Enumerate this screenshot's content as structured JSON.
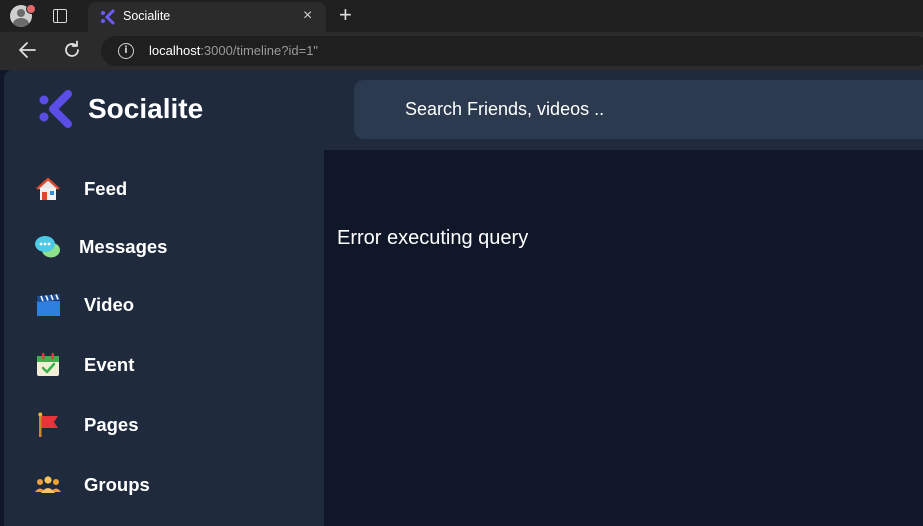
{
  "browser": {
    "tab": {
      "title": "Socialite",
      "favicon": "socialite-logo-icon",
      "close_glyph": "×"
    },
    "new_tab_glyph": "+",
    "info_glyph": "i",
    "url": {
      "host": "localhost",
      "rest": ":3000/timeline?id=1\""
    }
  },
  "app": {
    "brand": "Socialite",
    "accent_color": "#5b4ee6",
    "search": {
      "placeholder": "Search Friends, videos .."
    },
    "sidebar": {
      "items": [
        {
          "label": "Feed",
          "icon": "home-icon"
        },
        {
          "label": "Messages",
          "icon": "chat-bubbles-icon"
        },
        {
          "label": "Video",
          "icon": "clapperboard-icon"
        },
        {
          "label": "Event",
          "icon": "calendar-check-icon"
        },
        {
          "label": "Pages",
          "icon": "flag-icon"
        },
        {
          "label": "Groups",
          "icon": "people-group-icon"
        }
      ]
    },
    "main": {
      "error": "Error executing query"
    }
  }
}
